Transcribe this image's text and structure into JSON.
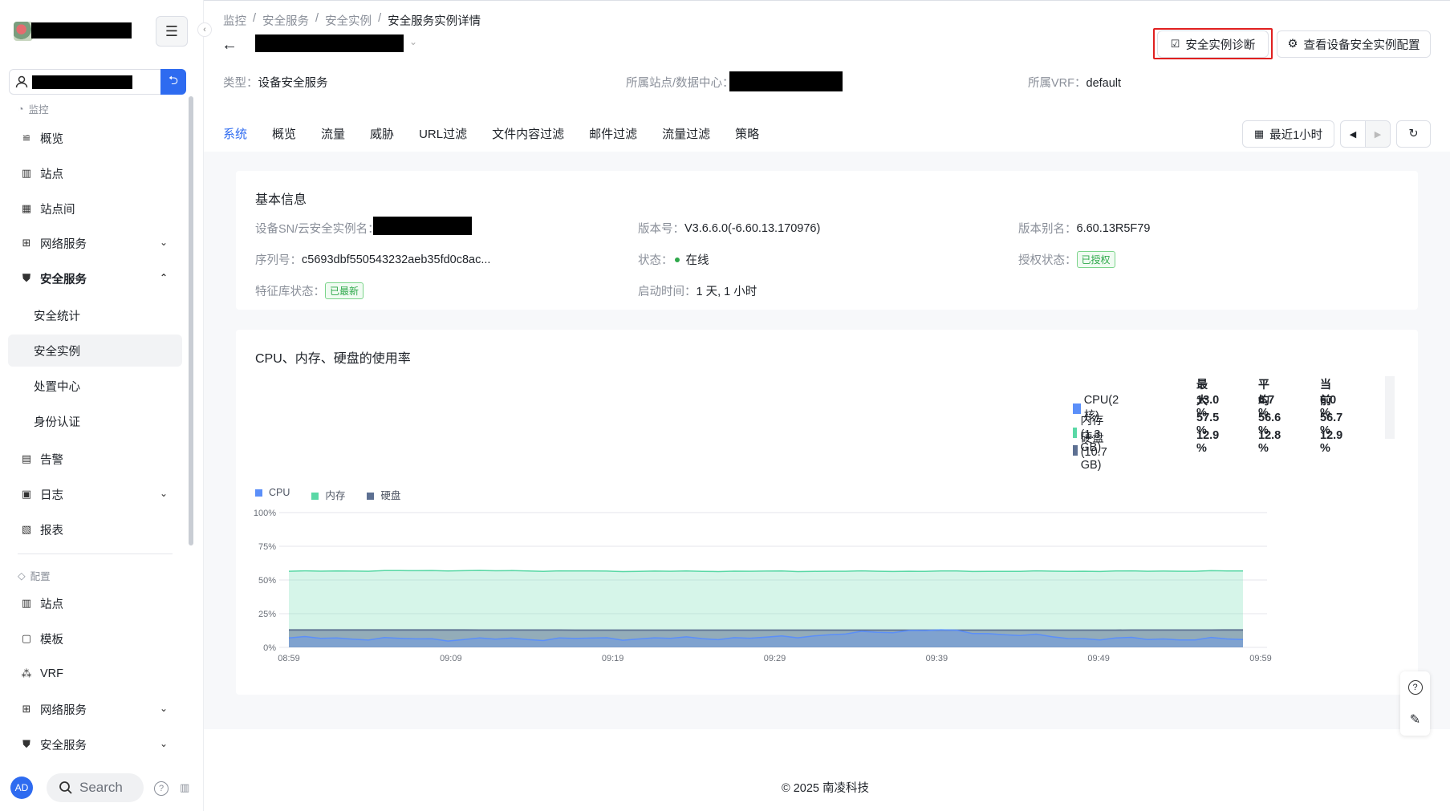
{
  "sidebar": {
    "sections": {
      "monitor": "监控",
      "config": "配置"
    },
    "monitor_items": [
      {
        "label": "概览",
        "icon": "overview-icon"
      },
      {
        "label": "站点",
        "icon": "site-icon"
      },
      {
        "label": "站点间",
        "icon": "inter-site-icon"
      },
      {
        "label": "网络服务",
        "icon": "network-icon"
      },
      {
        "label": "安全服务",
        "icon": "shield-icon"
      }
    ],
    "security_sub": [
      "安全统计",
      "安全实例",
      "处置中心",
      "身份认证"
    ],
    "monitor_items2": [
      {
        "label": "告警",
        "icon": "alarm-icon"
      },
      {
        "label": "日志",
        "icon": "log-icon"
      },
      {
        "label": "报表",
        "icon": "report-icon"
      }
    ],
    "config_items": [
      {
        "label": "站点",
        "icon": "site-icon"
      },
      {
        "label": "模板",
        "icon": "template-icon"
      },
      {
        "label": "VRF",
        "icon": "vrf-icon"
      },
      {
        "label": "网络服务",
        "icon": "network-icon"
      },
      {
        "label": "安全服务",
        "icon": "shield-icon"
      }
    ],
    "avatar": "AD",
    "search": "Search"
  },
  "breadcrumb": [
    "监控",
    "安全服务",
    "安全实例",
    "安全服务实例详情"
  ],
  "buttons": {
    "diagnose": "安全实例诊断",
    "view_config": "查看设备安全实例配置",
    "time_range": "最近1小时"
  },
  "meta": {
    "type_label": "类型：",
    "type_value": "设备安全服务",
    "site_label": "所属站点/数据中心：",
    "vrf_label": "所属VRF：",
    "vrf_value": "default"
  },
  "tabs": [
    "系统",
    "概览",
    "流量",
    "威胁",
    "URL过滤",
    "文件内容过滤",
    "邮件过滤",
    "流量过滤",
    "策略"
  ],
  "basic": {
    "title": "基本信息",
    "sn_label": "设备SN/云安全实例名：",
    "version_label": "版本号：",
    "version_value": "V3.6.6.0(-6.60.13.170976)",
    "alias_label": "版本别名：",
    "alias_value": "6.60.13R5F79",
    "serial_label": "序列号：",
    "serial_value": "c5693dbf550543232aeb35fd0c8ac...",
    "status_label": "状态：",
    "status_value": "在线",
    "license_label": "授权状态：",
    "license_value": "已授权",
    "sig_label": "特征库状态：",
    "sig_value": "已最新",
    "uptime_label": "启动时间：",
    "uptime_value": "1 天, 1 小时"
  },
  "usage": {
    "title": "CPU、内存、硬盘的使用率",
    "headers": [
      "最大",
      "平均",
      "当前"
    ],
    "rows": [
      {
        "name": "CPU(2核)",
        "color": "#5b8ff9",
        "max": "13.0 %",
        "avg": "6.7 %",
        "cur": "6.0 %"
      },
      {
        "name": "内存(1.3 GB)",
        "color": "#5ad8a6",
        "max": "57.5 %",
        "avg": "56.6 %",
        "cur": "56.7 %"
      },
      {
        "name": "硬盘(10.7 GB)",
        "color": "#5d7092",
        "max": "12.9 %",
        "avg": "12.8 %",
        "cur": "12.9 %"
      }
    ]
  },
  "chart_data": {
    "type": "area",
    "x": [
      "08:59",
      "09:09",
      "09:19",
      "09:29",
      "09:39",
      "09:49",
      "09:59"
    ],
    "y_ticks": [
      "100%",
      "75%",
      "50%",
      "25%",
      "0%"
    ],
    "ylim": [
      0,
      100
    ],
    "series": [
      {
        "name": "CPU",
        "color": "#5b8ff9",
        "values": [
          7,
          6,
          6.5,
          7,
          13,
          6.5,
          6
        ]
      },
      {
        "name": "内存",
        "color": "#5ad8a6",
        "values": [
          56.5,
          57,
          56.5,
          56.5,
          56.5,
          56.5,
          56.7
        ]
      },
      {
        "name": "硬盘",
        "color": "#5d7092",
        "values": [
          12.9,
          12.9,
          12.8,
          12.8,
          12.8,
          12.8,
          12.9
        ]
      }
    ]
  },
  "footer": "© 2025 南凌科技"
}
